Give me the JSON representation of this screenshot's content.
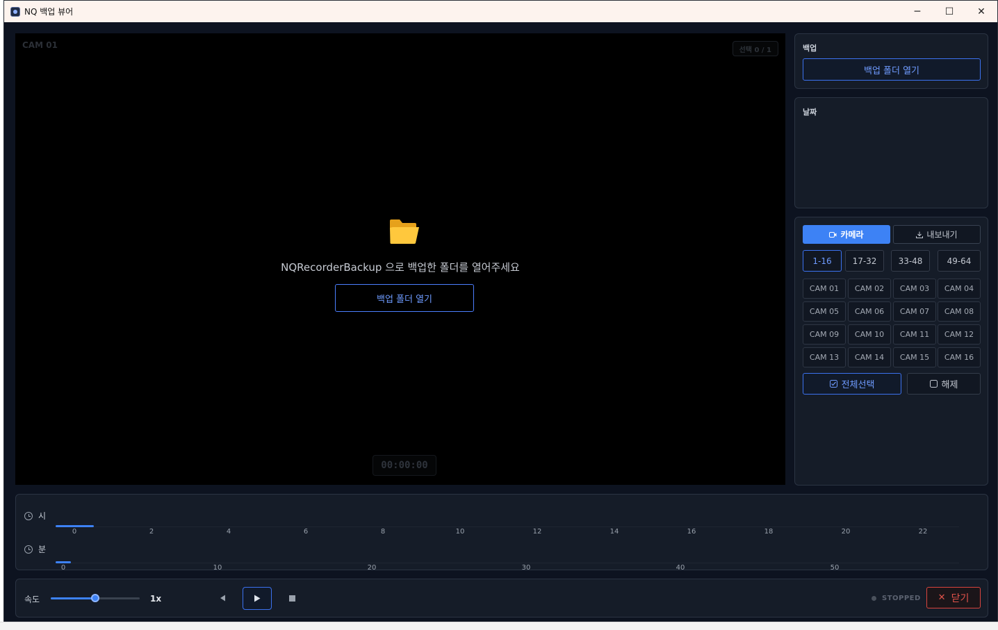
{
  "window": {
    "title": "NQ 백업 뷰어",
    "minimize": "─",
    "maximize": "☐",
    "close": "✕"
  },
  "video": {
    "cam_label": "CAM 01",
    "selection_badge": "선택 0 / 1",
    "message": "NQRecorderBackup 으로 백업한 폴더를 열어주세요",
    "open_button": "백업 폴더 열기",
    "timecode": "00:00:00",
    "folder_icon": "folder-icon"
  },
  "backup_panel": {
    "label": "백업",
    "open_button": "백업 폴더 열기"
  },
  "date_panel": {
    "label": "날짜"
  },
  "camera_panel": {
    "tabs": [
      {
        "label": "카메라",
        "icon": "camera-icon",
        "active": true
      },
      {
        "label": "내보내기",
        "icon": "download-icon",
        "active": false
      }
    ],
    "ranges": [
      {
        "label": "1-16",
        "active": true
      },
      {
        "label": "17-32",
        "active": false
      },
      {
        "label": "33-48",
        "active": false
      },
      {
        "label": "49-64",
        "active": false
      }
    ],
    "cameras": [
      "CAM 01",
      "CAM 02",
      "CAM 03",
      "CAM 04",
      "CAM 05",
      "CAM 06",
      "CAM 07",
      "CAM 08",
      "CAM 09",
      "CAM 10",
      "CAM 11",
      "CAM 12",
      "CAM 13",
      "CAM 14",
      "CAM 15",
      "CAM 16"
    ],
    "select_all": "전체선택",
    "deselect": "해제"
  },
  "timeline": {
    "hour_label": "시",
    "minute_label": "분",
    "hour_ticks": [
      "0",
      "2",
      "4",
      "6",
      "8",
      "10",
      "12",
      "14",
      "16",
      "18",
      "20",
      "22"
    ],
    "minute_ticks": [
      "0",
      "10",
      "20",
      "30",
      "40",
      "50"
    ]
  },
  "controls": {
    "speed_label": "속도",
    "speed_value": "1x",
    "speed_level": 0.5,
    "status": "STOPPED",
    "close_button": "닫기",
    "colors": {
      "accent": "#3d82f5",
      "danger": "#e0524a",
      "background": "#0d1320"
    }
  }
}
